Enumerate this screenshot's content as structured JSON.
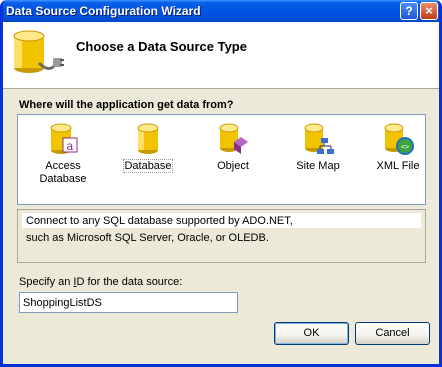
{
  "window": {
    "title": "Data Source Configuration Wizard",
    "help_label": "?",
    "close_label": "×"
  },
  "header": {
    "title": "Choose a Data Source Type"
  },
  "question": "Where will the application get data from?",
  "types": [
    {
      "label": "Access Database",
      "icon": "access-database-icon"
    },
    {
      "label": "Database",
      "icon": "database-icon",
      "selected": true
    },
    {
      "label": "Object",
      "icon": "object-icon"
    },
    {
      "label": "Site Map",
      "icon": "site-map-icon"
    },
    {
      "label": "XML File",
      "icon": "xml-file-icon"
    }
  ],
  "description": {
    "line1": "Connect to any SQL database supported by ADO.NET,",
    "line2": "such as Microsoft SQL Server, Oracle, or OLEDB."
  },
  "id_field": {
    "label_pre": "Specify an ",
    "label_key": "I",
    "label_post": "D for the data source:",
    "value": "ShoppingListDS"
  },
  "buttons": {
    "ok": "OK",
    "cancel": "Cancel"
  },
  "colors": {
    "titlebar": "#0054e3",
    "face": "#ece9d8",
    "cylinder": "#f2c400"
  }
}
